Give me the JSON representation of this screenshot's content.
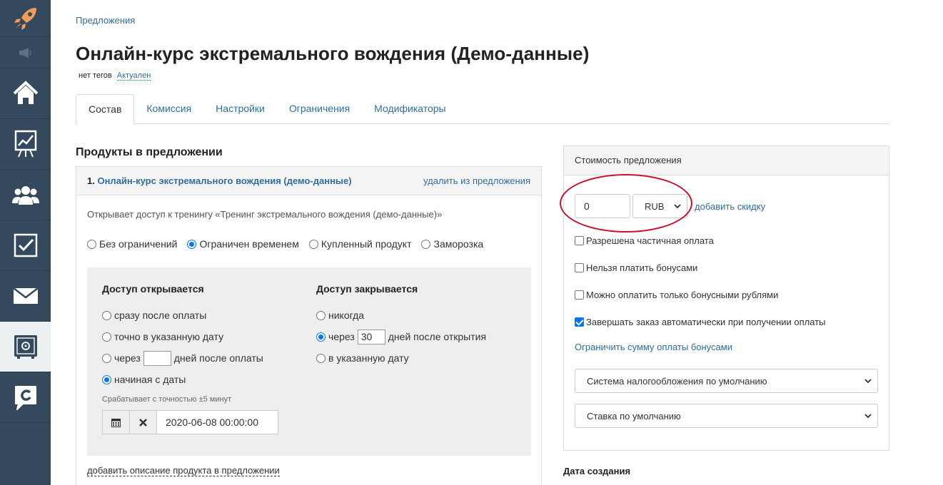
{
  "sidebar": {
    "items": [
      {
        "icon": "home-icon"
      },
      {
        "icon": "chart-icon"
      },
      {
        "icon": "users-icon"
      },
      {
        "icon": "checkbox-icon"
      },
      {
        "icon": "mail-icon"
      },
      {
        "icon": "safe-icon",
        "active": true
      },
      {
        "icon": "chat-icon"
      }
    ]
  },
  "header": {
    "breadcrumb": "Предложения",
    "title": "Онлайн-курс экстремального вождения (Демо-данные)",
    "tags": "нет тегов",
    "status": "Актуален"
  },
  "tabs": [
    "Состав",
    "Комиссия",
    "Настройки",
    "Ограничения",
    "Модификаторы"
  ],
  "products": {
    "section_title": "Продукты в предложении",
    "item": {
      "number": "1.",
      "name": "Онлайн-курс экстремального вождения (демо-данные)",
      "remove_label": "удалить из предложения",
      "description": "Открывает доступ к тренингу «Тренинг экстремального вождения (демо-данные)»",
      "limit_options": [
        "Без ограничений",
        "Ограничен временем",
        "Купленный продукт",
        "Заморозка"
      ],
      "access_open": {
        "title": "Доступ открывается",
        "options": [
          "сразу после оплаты",
          "точно в указанную дату",
          "через",
          "начиная с даты"
        ],
        "days_suffix": "дней после оплаты",
        "note": "Срабатывает с точностью ±5 минут",
        "date_value": "2020-06-08 00:00:00"
      },
      "access_close": {
        "title": "Доступ закрывается",
        "options": [
          "никогда",
          "через",
          "в указанную дату"
        ],
        "days_value": "30",
        "days_suffix": "дней после открытия"
      },
      "add_description": "добавить описание продукта в предложении"
    }
  },
  "price": {
    "title": "Стоимость предложения",
    "value": "0",
    "currency": "RUB",
    "add_discount": "добавить скидку",
    "checkboxes": [
      {
        "label": "Разрешена частичная оплата",
        "checked": false
      },
      {
        "label": "Нельзя платить бонусами",
        "checked": false
      },
      {
        "label": "Можно оплатить только бонусными рублями",
        "checked": false
      },
      {
        "label": "Завершать заказ автоматически при получении оплаты",
        "checked": true
      }
    ],
    "limit_bonus_link": "Ограничить сумму оплаты бонусами",
    "tax_system": "Система налогообложения по умолчанию",
    "tax_rate": "Ставка по умолчанию"
  },
  "date_created_label": "Дата создания",
  "colors": {
    "sidebar": "#34495e",
    "link": "#2f6ea3",
    "highlight_ring": "#c8102e",
    "accent": "#0075ff"
  }
}
